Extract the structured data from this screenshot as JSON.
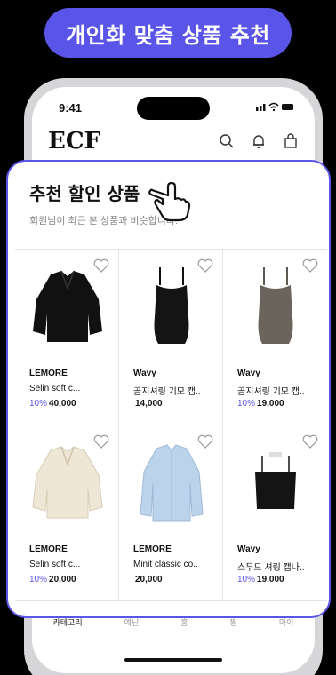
{
  "banner": {
    "text": "개인화 맞춤 상품 추천"
  },
  "status": {
    "time": "9:41",
    "icons": "••ıl ᯤ ▬"
  },
  "header": {
    "logo": "ECF"
  },
  "card": {
    "title": "추천 할인 상품",
    "subtitle": "회원님이 최근 본 상품과 비슷합니다."
  },
  "products": [
    {
      "brand": "LEMORE",
      "name": "Selin soft c...",
      "discount": "10%",
      "price": "40,000",
      "image": "black-fur-jacket"
    },
    {
      "brand": "Wavy",
      "name": "골지셔링 기모 캡..",
      "discount": "",
      "price": "14,000",
      "image": "black-camisole"
    },
    {
      "brand": "Wavy",
      "name": "골지셔링 기모 캡..",
      "discount": "10%",
      "price": "19,000",
      "image": "taupe-camisole"
    },
    {
      "brand": "LEMORE",
      "name": "Selin soft c...",
      "discount": "10%",
      "price": "20,000",
      "image": "cream-fur-jacket"
    },
    {
      "brand": "LEMORE",
      "name": "Minit classic co..",
      "discount": "",
      "price": "20,000",
      "image": "light-blue-shirt"
    },
    {
      "brand": "Wavy",
      "name": "스무드 셔링 캡나..",
      "discount": "10%",
      "price": "19,000",
      "image": "black-tube-top"
    }
  ],
  "bottom_nav": [
    "카테고리",
    "예닌",
    "홈",
    "찜",
    "마이"
  ],
  "colors": {
    "accent": "#5a55e8"
  }
}
